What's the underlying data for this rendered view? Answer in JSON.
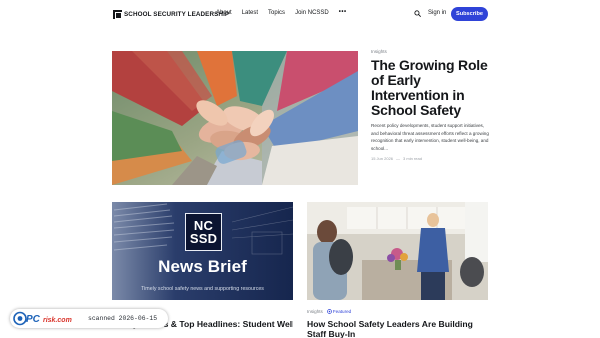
{
  "header": {
    "logo_text": "School Security Leadership",
    "nav": [
      "About",
      "Latest",
      "Topics",
      "Join NCSSD"
    ],
    "more": "•••",
    "signin": "Sign in",
    "subscribe": "Subscribe"
  },
  "featured": {
    "tag": "Insights",
    "title": "The Growing Role of Early Intervention in School Safety",
    "excerpt": "Recent policy developments, student support initiatives, and behavioral threat assessment efforts reflect a growing recognition that early intervention, student well-being, and school...",
    "date": "15 Jun 2026",
    "separator": "—",
    "read_time": "3 min read"
  },
  "card1": {
    "graphic_box_top": "NC",
    "graphic_box_bottom": "SSD",
    "graphic_title": "News Brief",
    "graphic_subtitle": "Timely school safety news and supporting resources",
    "title": "Safety Trends & Top Headlines: Student Wellness, Safety Funding, and"
  },
  "card2": {
    "tag": "Insights",
    "featured_label": "Featured",
    "title": "How School Safety Leaders Are Building Staff Buy-In"
  },
  "watermark": {
    "logo": "PCrisk.com",
    "text": "scanned 2026-06-15"
  },
  "colors": {
    "accent": "#2f43d8",
    "text": "#15171a",
    "muted": "#7c8188"
  }
}
